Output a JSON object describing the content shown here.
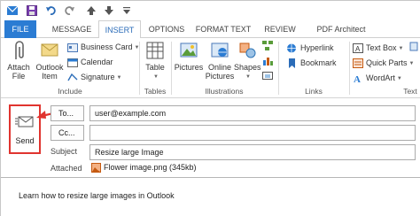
{
  "quick_access": {
    "icons": [
      "outlook-icon",
      "save-icon",
      "undo-icon",
      "redo-icon",
      "up-arrow-icon",
      "down-arrow-icon",
      "customize-icon"
    ]
  },
  "tabs": [
    {
      "label": "FILE"
    },
    {
      "label": "MESSAGE"
    },
    {
      "label": "INSERT"
    },
    {
      "label": "OPTIONS"
    },
    {
      "label": "FORMAT TEXT"
    },
    {
      "label": "REVIEW"
    },
    {
      "label": "PDF Architect"
    }
  ],
  "ribbon": {
    "include": {
      "label": "Include",
      "attach_file": [
        "Attach",
        "File"
      ],
      "outlook_item": [
        "Outlook",
        "Item"
      ],
      "business_card": "Business Card",
      "calendar": "Calendar",
      "signature": "Signature"
    },
    "tables": {
      "label": "Tables",
      "table": "Table"
    },
    "illustrations": {
      "label": "Illustrations",
      "pictures": "Pictures",
      "online_pictures": [
        "Online",
        "Pictures"
      ],
      "shapes": "Shapes"
    },
    "links": {
      "label": "Links",
      "hyperlink": "Hyperlink",
      "bookmark": "Bookmark"
    },
    "text": {
      "label": "Text",
      "text_box": "Text Box",
      "quick_parts": "Quick Parts",
      "wordart": "WordArt"
    }
  },
  "mail": {
    "send_label": "Send",
    "to_button": "To...",
    "to_value": "user@example.com",
    "cc_button": "Cc...",
    "cc_value": "",
    "subject_label": "Subject",
    "subject_value": "Resize large Image",
    "attached_label": "Attached",
    "attachment": "Flower image.png (345kb)"
  },
  "body": {
    "text": "Learn how to resize large images in Outlook"
  },
  "colors": {
    "file_tab": "#2b7cd3",
    "highlight": "#e0342f",
    "accent": "#2b6cb8"
  }
}
